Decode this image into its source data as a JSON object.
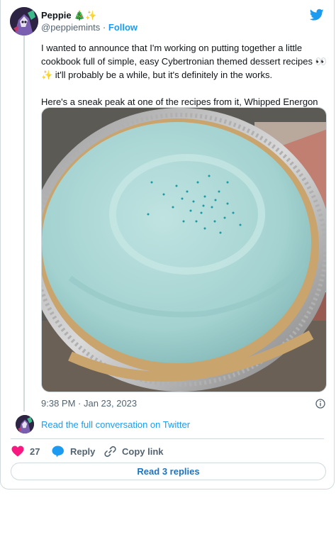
{
  "author": {
    "name": "Peppie",
    "emoji": "🎄✨",
    "handle": "@peppiemints",
    "separator": "·",
    "follow_label": "Follow"
  },
  "tweet": {
    "paragraphs": [
      "I wanted to announce that I'm working on putting together a little cookbook full of simple, easy Cybertronian themed dessert recipes 👀✨ it'll probably be a while, but it's definitely in the works.",
      "Here's a sneak peak at one of the recipes from it, Whipped Energon Pie!"
    ],
    "image_alt": "Whipped Energon Pie",
    "timestamp": "9:38 PM · Jan 23, 2023"
  },
  "conversation": {
    "read_full_label": "Read the full conversation on Twitter"
  },
  "actions": {
    "like_count": "27",
    "reply_label": "Reply",
    "copy_link_label": "Copy link",
    "read_replies_label": "Read 3 replies"
  },
  "colors": {
    "accent": "#1d9bf0",
    "heart": "#f91880",
    "text": "#0f1419",
    "muted": "#536471",
    "border": "#cfd9de",
    "pie_filling": "#a9d6d4",
    "sprinkles": "#1a9aa3"
  },
  "icons": {
    "logo": "twitter-bird-icon",
    "like": "heart-icon",
    "reply": "speech-bubble-icon",
    "copy": "link-icon",
    "info": "info-icon"
  }
}
